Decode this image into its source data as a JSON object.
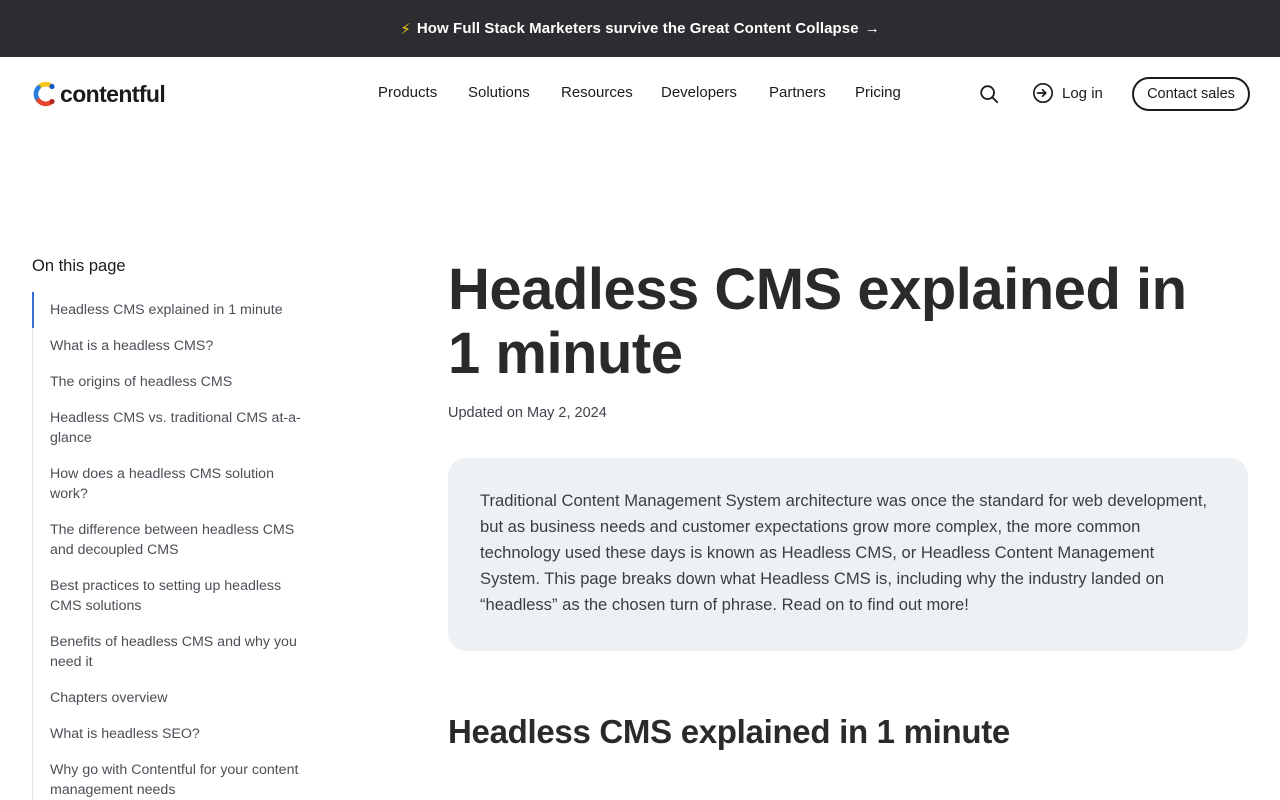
{
  "announcement": {
    "icon": "lightning-bolt-icon",
    "text": "How Full Stack Marketers survive the Great Content Collapse",
    "arrow": "→"
  },
  "header": {
    "logo_text": "contentful",
    "nav": [
      "Products",
      "Solutions",
      "Resources",
      "Developers",
      "Partners",
      "Pricing"
    ],
    "login_label": "Log in",
    "contact_label": "Contact sales"
  },
  "toc": {
    "title": "On this page",
    "items": [
      "Headless CMS explained in 1 minute",
      "What is a headless CMS?",
      "The origins of headless CMS",
      "Headless CMS vs. traditional CMS at-a-glance",
      "How does a headless CMS solution work?",
      "The difference between headless CMS and decoupled CMS",
      "Best practices to setting up headless CMS solutions",
      "Benefits of headless CMS and why you need it",
      "Chapters overview",
      "What is headless SEO?",
      "Why go with Contentful for your content management needs"
    ]
  },
  "article": {
    "title": "Headless CMS explained in 1 minute",
    "updated": "Updated on May 2, 2024",
    "intro": "Traditional Content Management System architecture was once the standard for web development, but as business needs and customer expectations grow more complex, the more common technology used these days is known as Headless CMS, or Headless Content Management System. This page breaks down what Headless CMS is, including why the industry landed on “headless” as the chosen turn of phrase. Read on to find out more!",
    "section_heading": "Headless CMS explained in 1 minute"
  },
  "colors": {
    "announcement_bg": "#2b2d30",
    "active_accent": "#3a6fd8",
    "intro_bg": "#eef1f4"
  }
}
